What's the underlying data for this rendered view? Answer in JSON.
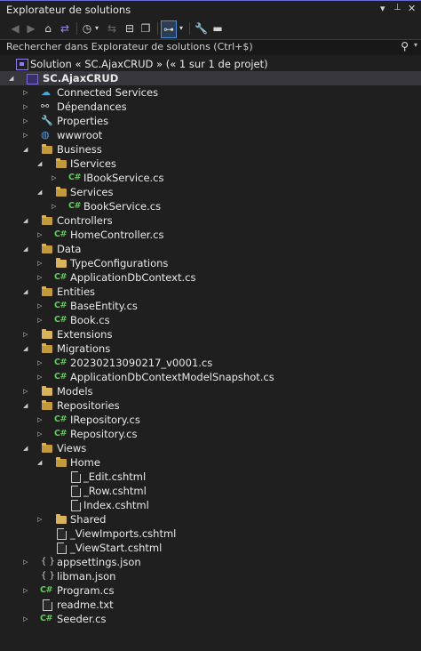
{
  "window": {
    "title": "Explorateur de solutions",
    "controls": {
      "dropdown": "▾",
      "pin": "📌",
      "close": "✕"
    }
  },
  "search": {
    "placeholder": "Rechercher dans Explorateur de solutions (Ctrl+$)"
  },
  "toolbar": {
    "items": [
      "back-icon",
      "forward-icon",
      "home-icon",
      "switch-views-icon",
      "history-icon",
      "sync-icon",
      "collapse-all-icon",
      "show-all-files-icon",
      "preview-selected-icon",
      "properties-icon",
      "filter-icon"
    ]
  },
  "solution": {
    "label": "Solution « SC.AjaxCRUD » (« 1 sur 1 de projet)"
  },
  "tree": [
    {
      "label": "SC.AjaxCRUD",
      "icon": "project-icon",
      "expanded": true,
      "bold": true
    },
    {
      "label": "Connected Services",
      "icon": "connected-services-icon",
      "expanded": false
    },
    {
      "label": "Dépendances",
      "icon": "dependencies-icon",
      "expanded": false
    },
    {
      "label": "Properties",
      "icon": "properties-folder-icon",
      "expanded": false
    },
    {
      "label": "wwwroot",
      "icon": "globe-icon",
      "expanded": false
    },
    {
      "label": "Business",
      "icon": "folder-icon",
      "expanded": true
    },
    {
      "label": "IServices",
      "icon": "folder-icon",
      "expanded": true
    },
    {
      "label": "IBookService.cs",
      "icon": "csharp-file-icon",
      "expanded": false
    },
    {
      "label": "Services",
      "icon": "folder-icon",
      "expanded": true
    },
    {
      "label": "BookService.cs",
      "icon": "csharp-file-icon",
      "expanded": false
    },
    {
      "label": "Controllers",
      "icon": "folder-icon",
      "expanded": true
    },
    {
      "label": "HomeController.cs",
      "icon": "csharp-file-icon",
      "expanded": false
    },
    {
      "label": "Data",
      "icon": "folder-icon",
      "expanded": true
    },
    {
      "label": "TypeConfigurations",
      "icon": "folder-icon",
      "expanded": false
    },
    {
      "label": "ApplicationDbContext.cs",
      "icon": "csharp-file-icon",
      "expanded": false
    },
    {
      "label": "Entities",
      "icon": "folder-icon",
      "expanded": true
    },
    {
      "label": "BaseEntity.cs",
      "icon": "csharp-file-icon",
      "expanded": false
    },
    {
      "label": "Book.cs",
      "icon": "csharp-file-icon",
      "expanded": false
    },
    {
      "label": "Extensions",
      "icon": "folder-icon",
      "expanded": false
    },
    {
      "label": "Migrations",
      "icon": "folder-icon",
      "expanded": true
    },
    {
      "label": "20230213090217_v0001.cs",
      "icon": "csharp-file-icon",
      "expanded": false
    },
    {
      "label": "ApplicationDbContextModelSnapshot.cs",
      "icon": "csharp-file-icon",
      "expanded": false
    },
    {
      "label": "Models",
      "icon": "folder-icon",
      "expanded": false
    },
    {
      "label": "Repositories",
      "icon": "folder-icon",
      "expanded": true
    },
    {
      "label": "IRepository.cs",
      "icon": "csharp-file-icon",
      "expanded": false
    },
    {
      "label": "Repository.cs",
      "icon": "csharp-file-icon",
      "expanded": false
    },
    {
      "label": "Views",
      "icon": "folder-icon",
      "expanded": true
    },
    {
      "label": "Home",
      "icon": "folder-icon",
      "expanded": true
    },
    {
      "label": "_Edit.cshtml",
      "icon": "razor-file-icon"
    },
    {
      "label": "_Row.cshtml",
      "icon": "razor-file-icon"
    },
    {
      "label": "Index.cshtml",
      "icon": "razor-file-icon"
    },
    {
      "label": "Shared",
      "icon": "folder-icon",
      "expanded": false
    },
    {
      "label": "_ViewImports.cshtml",
      "icon": "razor-file-icon"
    },
    {
      "label": "_ViewStart.cshtml",
      "icon": "razor-file-icon"
    },
    {
      "label": "appsettings.json",
      "icon": "json-file-icon",
      "expanded": false
    },
    {
      "label": "libman.json",
      "icon": "json-file-icon"
    },
    {
      "label": "Program.cs",
      "icon": "csharp-file-icon",
      "expanded": false
    },
    {
      "label": "readme.txt",
      "icon": "text-file-icon"
    },
    {
      "label": "Seeder.cs",
      "icon": "csharp-file-icon",
      "expanded": false
    }
  ],
  "colors": {
    "background": "#1f1f1f",
    "selection": "#37373d",
    "folder": "#d9b25c",
    "csharp": "#5fc95f",
    "accent": "#4d8fd6"
  }
}
